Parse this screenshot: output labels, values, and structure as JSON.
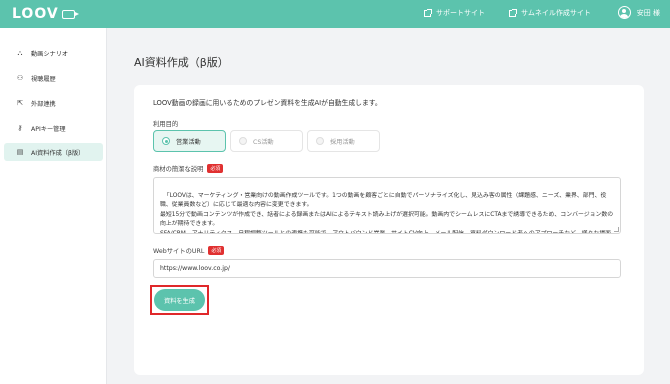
{
  "header": {
    "logo_text": "LOOV",
    "links": [
      "サポートサイト",
      "サムネイル作成サイト"
    ],
    "user_name": "安田 様"
  },
  "sidebar": {
    "items": [
      {
        "label": "動画シナリオ",
        "icon": "scenario-icon",
        "active": false
      },
      {
        "label": "視聴履歴",
        "icon": "viewer-history-icon",
        "active": false
      },
      {
        "label": "外部連携",
        "icon": "external-link-icon",
        "active": false
      },
      {
        "label": "APIキー管理",
        "icon": "key-icon",
        "active": false
      },
      {
        "label": "AI資料作成（β版）",
        "icon": "document-icon",
        "active": true
      }
    ]
  },
  "main": {
    "title": "AI資料作成（β版）",
    "intro": "LOOV動画の録画に用いるためのプレゼン資料を生成AIが自動生成します。",
    "purpose_label": "利用目的",
    "purpose_options": [
      "営業活動",
      "CS活動",
      "採用活動"
    ],
    "purpose_selected": "営業活動",
    "description_label": "商材の簡潔な説明",
    "required_badge": "必須",
    "description_value": "「LOOVは、マーケティング・営業向けの動画作成ツールです。1つの動画を顧客ごとに自動でパーソナライズ化し、見込み客の属性（課題感、ニーズ、業界、部門、役職、従業員数など）に応じて最適な内容に変更できます。\n最短15分で動画コンテンツが作成でき、話者による録画またはAIによるテキスト読み上げが選択可能。動画内でシームレスにCTAまで誘導できるため、コンバージョン数の向上が期待できます。\nSFA/CRM、アナリティクス、日程調整ツールとの連携も可能で、アウトバウンド営業、サイトCV向上、メール配信、資料ダウンロード者へのアプローチなど、様々な場面で活用できます。",
    "url_label": "WebサイトのURL",
    "url_value": "https://www.loov.co.jp/",
    "generate_button": "資料を生成"
  },
  "colors": {
    "brand": "#5cc3ad",
    "highlight": "#e0282a",
    "required": "#e03030"
  }
}
